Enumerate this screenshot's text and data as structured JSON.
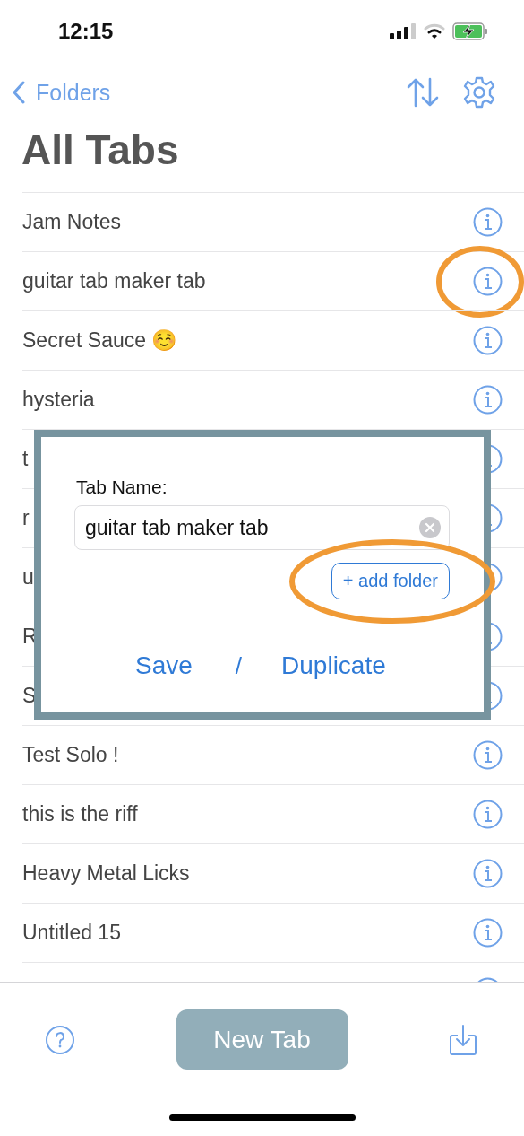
{
  "status_bar": {
    "time": "12:15"
  },
  "nav": {
    "back_label": "Folders"
  },
  "title": "All Tabs",
  "rows": [
    {
      "title": "Jam Notes",
      "circled": false
    },
    {
      "title": "guitar tab maker tab",
      "circled": true
    },
    {
      "title": "Secret Sauce ☺️",
      "circled": false
    },
    {
      "title": "hysteria",
      "circled": false
    },
    {
      "title": "t",
      "circled": false
    },
    {
      "title": "r",
      "circled": false
    },
    {
      "title": "u",
      "circled": false
    },
    {
      "title": "R",
      "circled": false
    },
    {
      "title": "S",
      "circled": false
    },
    {
      "title": "Test Solo !",
      "circled": false
    },
    {
      "title": "this is the riff",
      "circled": false
    },
    {
      "title": "Heavy Metal Licks",
      "circled": false
    },
    {
      "title": "Untitled 15",
      "circled": false
    }
  ],
  "dialog": {
    "label": "Tab Name:",
    "value": "guitar tab maker tab",
    "add_folder": {
      "label": "+ add folder",
      "circled": true
    },
    "save": "Save",
    "separator": "/",
    "duplicate": "Duplicate"
  },
  "bottom_bar": {
    "new_tab": "New Tab"
  }
}
